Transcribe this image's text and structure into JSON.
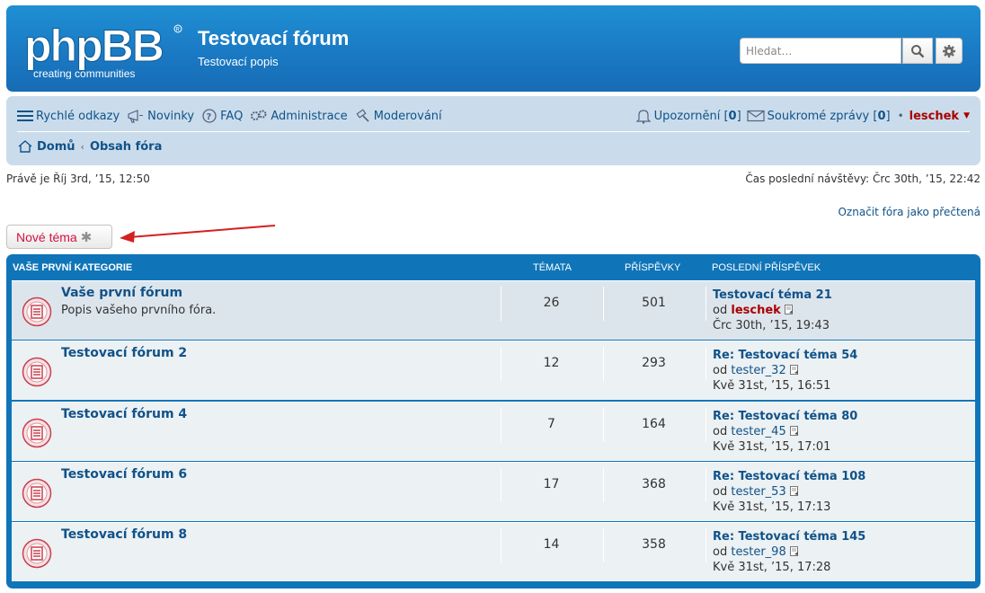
{
  "header": {
    "logo_word": "phpBB",
    "logo_tagline": "creating communities",
    "title": "Testovací fórum",
    "description": "Testovací popis",
    "search_placeholder": "Hledat…"
  },
  "nav": {
    "quick_links": "Rychlé odkazy",
    "news": "Novinky",
    "faq": "FAQ",
    "admin": "Administrace",
    "moderate": "Moderování",
    "notifications_label": "Upozornění",
    "notifications_count": "0",
    "pm_label": "Soukromé zprávy",
    "pm_count": "0",
    "username": "leschek"
  },
  "breadcrumbs": {
    "home": "Domů",
    "index": "Obsah fóra"
  },
  "info": {
    "now": "Právě je Říj 3rd, ’15, 12:50",
    "last_visit": "Čas poslední návštěvy: Črc 30th, ’15, 22:42",
    "mark_read": "Označit fóra jako přečtená"
  },
  "new_topic_label": "Nové téma",
  "table": {
    "category": "Vaše první kategorie",
    "col_topics": "Témata",
    "col_posts": "Příspěvky",
    "col_last": "Poslední příspěvek",
    "forums": [
      {
        "name": "Vaše první fórum",
        "desc": "Popis vašeho prvního fóra.",
        "topics": "26",
        "posts": "501",
        "last_title": "Testovací téma 21",
        "by": "od",
        "author": "leschek",
        "date": "Črc 30th, ’15, 19:43"
      },
      {
        "name": "Testovací fórum 2",
        "desc": "",
        "topics": "12",
        "posts": "293",
        "last_title": "Re: Testovací téma 54",
        "by": "od",
        "author": "tester_32",
        "date": "Kvě 31st, ’15, 16:51"
      },
      {
        "name": "Testovací fórum 4",
        "desc": "",
        "topics": "7",
        "posts": "164",
        "last_title": "Re: Testovací téma 80",
        "by": "od",
        "author": "tester_45",
        "date": "Kvě 31st, ’15, 17:01"
      },
      {
        "name": "Testovací fórum 6",
        "desc": "",
        "topics": "17",
        "posts": "368",
        "last_title": "Re: Testovací téma 108",
        "by": "od",
        "author": "tester_53",
        "date": "Kvě 31st, ’15, 17:13"
      },
      {
        "name": "Testovací fórum 8",
        "desc": "",
        "topics": "14",
        "posts": "358",
        "last_title": "Re: Testovací téma 145",
        "by": "od",
        "author": "tester_98",
        "date": "Kvě 31st, ’15, 17:28"
      }
    ]
  },
  "colors": {
    "accent": "#105289",
    "header_blue": "#1a78c2",
    "admin_red": "#aa0000",
    "new_topic_red": "#d31141"
  }
}
